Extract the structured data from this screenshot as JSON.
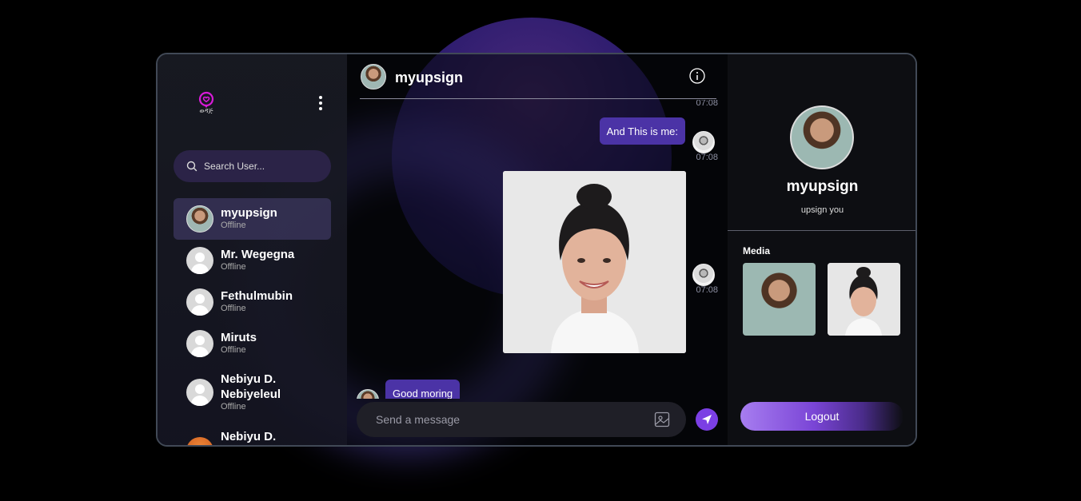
{
  "app": {
    "logo_text": "ወዳጅ",
    "menu_icon": "kebab-icon"
  },
  "sidebar": {
    "search_placeholder": "Search User...",
    "contacts": [
      {
        "name": "myupsign",
        "status": "Offline",
        "active": true
      },
      {
        "name": "Mr. Wegegna",
        "status": "Offline"
      },
      {
        "name": "Fethulmubin",
        "status": "Offline"
      },
      {
        "name": "Miruts",
        "status": "Offline"
      },
      {
        "name": "Nebiyu D. Nebiyeleul",
        "status": "Offline"
      },
      {
        "name": "Nebiyu D.",
        "status": ""
      }
    ]
  },
  "chat": {
    "title": "myupsign",
    "messages": [
      {
        "time": "07:08"
      },
      {
        "text": "And This is me:",
        "time": "07:08",
        "direction": "out"
      },
      {
        "type": "image",
        "time": "07:08",
        "direction": "out"
      },
      {
        "text": "Good moring",
        "direction": "in"
      }
    ],
    "composer_placeholder": "Send a message"
  },
  "profile": {
    "name": "myupsign",
    "bio": "upsign you",
    "media_label": "Media",
    "logout_label": "Logout"
  },
  "colors": {
    "accent": "#7b3fe4",
    "bubble": "#4b33a6",
    "panel": "#0d0e12"
  }
}
